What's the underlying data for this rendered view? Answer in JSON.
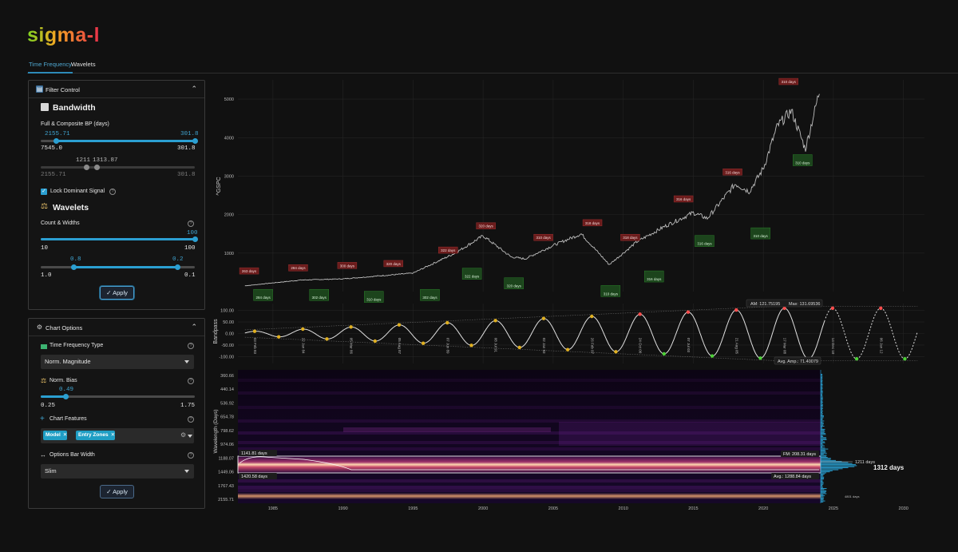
{
  "app": {
    "logo": "sigma-l"
  },
  "tabs": [
    {
      "label": "Time Frequency",
      "active": true
    },
    {
      "label": "Wavelets",
      "active": false
    }
  ],
  "filter_control": {
    "title": "Filter Control",
    "bandwidth_heading": "Bandwidth",
    "bp_label": "Full & Composite BP (days)",
    "bp_values": {
      "low": "2155.71",
      "high": "301.8",
      "min": "7545.0",
      "max": "301.8"
    },
    "composite_values": {
      "a": "1211",
      "b": "1313.87",
      "min": "2155.71",
      "max": "301.8"
    },
    "lock_label": "Lock Dominant Signal",
    "lock_checked": true,
    "wavelets_heading": "Wavelets",
    "count_label": "Count & Widths",
    "count_values": {
      "current": "100",
      "min": "10",
      "max": "100"
    },
    "width_values": {
      "low": "0.8",
      "high": "0.2",
      "min": "1.0",
      "max": "0.1"
    },
    "apply_label": "Apply"
  },
  "chart_options": {
    "title": "Chart Options",
    "tf_type_label": "Time Frequency Type",
    "tf_type_value": "Norm. Magnitude",
    "bias_label": "Norm. Bias",
    "bias_values": {
      "current": "0.49",
      "min": "0.25",
      "max": "1.75"
    },
    "features_label": "Chart Features",
    "features": [
      {
        "label": "Model"
      },
      {
        "label": "Entry Zones"
      }
    ],
    "bar_width_label": "Options Bar Width",
    "bar_width_value": "Slim",
    "apply_label": "Apply"
  },
  "chart_data": [
    {
      "type": "line",
      "ylabel": "^GSPC",
      "y_ticks": [
        "1000",
        "2000",
        "3000",
        "4000",
        "5000"
      ],
      "ylim": [
        0,
        5500
      ],
      "x": [
        1983,
        1987,
        1990,
        1995,
        1998,
        2000,
        2002,
        2003,
        2005,
        2007,
        2009,
        2011,
        2013,
        2015,
        2016,
        2018,
        2019,
        2020,
        2021,
        2022,
        2023,
        2024
      ],
      "y": [
        150,
        300,
        330,
        480,
        1000,
        1450,
        900,
        850,
        1200,
        1500,
        700,
        1300,
        1700,
        2050,
        1900,
        2800,
        2600,
        3200,
        4300,
        4700,
        3700,
        5200
      ],
      "peak_labels": [
        {
          "x": 1983.3,
          "y": 330,
          "text": "263 days"
        },
        {
          "x": 1986.8,
          "y": 410,
          "text": "284 days"
        },
        {
          "x": 1990.3,
          "y": 470,
          "text": "300 days"
        },
        {
          "x": 1993.6,
          "y": 520,
          "text": "320 days"
        },
        {
          "x": 1997.5,
          "y": 870,
          "text": "322 days"
        },
        {
          "x": 2000.2,
          "y": 1500,
          "text": "320 days"
        },
        {
          "x": 2004.3,
          "y": 1200,
          "text": "310 days"
        },
        {
          "x": 2007.8,
          "y": 1580,
          "text": "318 days"
        },
        {
          "x": 2010.5,
          "y": 1200,
          "text": "318 days"
        },
        {
          "x": 2014.3,
          "y": 2200,
          "text": "316 days"
        },
        {
          "x": 2017.8,
          "y": 2900,
          "text": "316 days"
        },
        {
          "x": 2021.8,
          "y": 5250,
          "text": "310 days"
        }
      ],
      "trough_labels": [
        {
          "x": 1984.3,
          "y": 100,
          "text": "284 days"
        },
        {
          "x": 1988.3,
          "y": 100,
          "text": "302 days"
        },
        {
          "x": 1992.2,
          "y": 50,
          "text": "310 days"
        },
        {
          "x": 1996.2,
          "y": 100,
          "text": "302 days"
        },
        {
          "x": 1999.2,
          "y": 650,
          "text": "322 days"
        },
        {
          "x": 2002.2,
          "y": 400,
          "text": "320 days"
        },
        {
          "x": 2009.1,
          "y": 200,
          "text": "310 days"
        },
        {
          "x": 2012.2,
          "y": 580,
          "text": "316 days"
        },
        {
          "x": 2015.8,
          "y": 1500,
          "text": "316 days"
        },
        {
          "x": 2019.8,
          "y": 1700,
          "text": "310 days"
        },
        {
          "x": 2022.8,
          "y": 3600,
          "text": "310 days"
        }
      ]
    },
    {
      "type": "line",
      "ylabel": "Bandpass",
      "y_ticks": [
        "100.00",
        "50.00",
        "0.00",
        "-50.00",
        "-100.00"
      ],
      "ylim": [
        -130,
        130
      ],
      "stats": {
        "am": "AM: 121.75195",
        "max": "Max: 131.69536",
        "avg_amp": "Avg. Amp.: 71.40079"
      },
      "period_days": 310,
      "x_start": 1983,
      "x_end": 2031,
      "x_forecast": 2024.4,
      "date_labels": [
        "03 Feb 83",
        "22 Jan 84",
        "05 Mar 86",
        "05 Aug 87",
        "07 Jun 89",
        "08 Jul 91",
        "02 Jan 93",
        "26 Feb 97",
        "24 Oct 00",
        "07 Jul 03",
        "21 Aug 05",
        "17 Mar 08",
        "14 Dec 10",
        "06 Jan 12",
        "13 Oct 13",
        "04 May 15",
        "11 Jan 17",
        "03 Aug 19",
        "20 Jun 21",
        "17 Apr 23",
        "23 Sep 25",
        "06 Mar 27",
        "04 Jun 29",
        "27 Oct 30"
      ]
    },
    {
      "type": "heatmap",
      "ylabel": "Wavelength (Days)",
      "y_ticks": [
        "360.66",
        "440.14",
        "536.92",
        "654.78",
        "798.62",
        "974.06",
        "1188.07",
        "1449.06",
        "1767.43",
        "2155.71"
      ],
      "x_ticks": [
        "1985",
        "1990",
        "1995",
        "2000",
        "2005",
        "2010",
        "2015",
        "2020",
        "2025",
        "2030"
      ],
      "xlim": [
        1982.5,
        2031.5
      ],
      "band_top_label": "1141.81 days",
      "band_bottom_label": "1420.58 days",
      "fm_label": "FM: 208.31 days",
      "avg_label": "Avg.: 1288.84 days",
      "side_labels": {
        "a": "1211 days",
        "b": "1312 days",
        "c": "4801 days"
      }
    }
  ]
}
